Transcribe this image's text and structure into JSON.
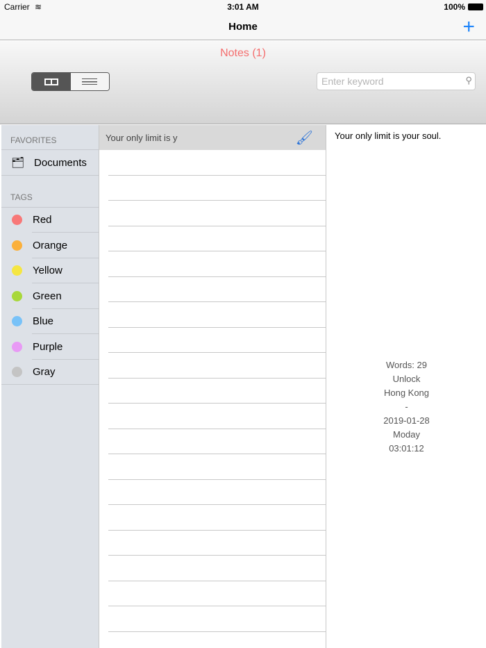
{
  "status": {
    "carrier": "Carrier",
    "time": "3:01 AM",
    "battery": "100%"
  },
  "nav": {
    "title": "Home",
    "add": "+"
  },
  "toolbar": {
    "notes_title": "Notes (1)",
    "search_placeholder": "Enter keyword"
  },
  "sidebar": {
    "favorites_header": "FAVORITES",
    "favorites": [
      {
        "label": "Documents"
      }
    ],
    "tags_header": "TAGS",
    "tags": [
      {
        "label": "Red",
        "color": "#f87878"
      },
      {
        "label": "Orange",
        "color": "#fbb03b"
      },
      {
        "label": "Yellow",
        "color": "#f5e642"
      },
      {
        "label": "Green",
        "color": "#a8d83a"
      },
      {
        "label": "Blue",
        "color": "#78c2f8"
      },
      {
        "label": "Purple",
        "color": "#e89af5"
      },
      {
        "label": "Gray",
        "color": "#c4c4c4"
      }
    ]
  },
  "list": {
    "notes": [
      {
        "preview": "Your only limit is y"
      }
    ]
  },
  "detail": {
    "text": "Your only limit is your soul.",
    "words": "Words: 29",
    "lock": "Unlock",
    "location": "Hong Kong",
    "separator": "-",
    "date": "2019-01-28",
    "weekday": "Moday",
    "time": "03:01:12"
  }
}
